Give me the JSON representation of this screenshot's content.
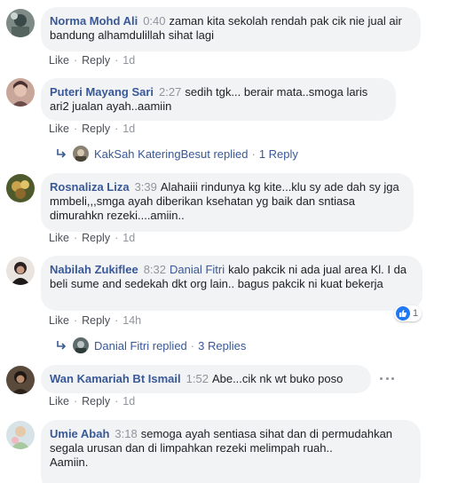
{
  "comments": [
    {
      "author": "Norma Mohd Ali",
      "time": "0:40",
      "mention": "",
      "text": "zaman kita sekolah rendah pak cik nie jual air bandung alhamdulillah sihat lagi",
      "actions": {
        "like": "Like",
        "reply": "Reply",
        "age": "1d"
      }
    },
    {
      "author": "Puteri Mayang Sari",
      "time": "2:27",
      "mention": "",
      "text": "sedih tgk... berair mata..smoga laris ari2 jualan ayah..aamiin",
      "actions": {
        "like": "Like",
        "reply": "Reply",
        "age": "1d"
      },
      "replies": {
        "name": "KakSah KateringBesut",
        "verb": "replied",
        "count": "1 Reply"
      }
    },
    {
      "author": "Rosnaliza Liza",
      "time": "3:39",
      "mention": "",
      "text": "Alahaiii rindunya kg kite...klu sy ade dah sy jga mmbeli,,,smga ayah diberikan ksehatan yg baik dan sntiasa dimurahkn rezeki....amiin..",
      "actions": {
        "like": "Like",
        "reply": "Reply",
        "age": "1d"
      }
    },
    {
      "author": "Nabilah Zukiflee",
      "time": "8:32",
      "mention": "Danial Fitri",
      "text": "kalo pakcik ni ada jual area Kl. I da beli sume and sedekah dkt org lain.. bagus pakcik ni kuat bekerja",
      "actions": {
        "like": "Like",
        "reply": "Reply",
        "age": "14h"
      },
      "reaction_count": "1",
      "replies": {
        "name": "Danial Fitri",
        "verb": "replied",
        "count": "3 Replies"
      }
    },
    {
      "author": "Wan Kamariah Bt Ismail",
      "time": "1:52",
      "mention": "",
      "text": "Abe...cik nk wt buko poso",
      "actions": {
        "like": "Like",
        "reply": "Reply",
        "age": "1d"
      }
    },
    {
      "author": "Umie Abah",
      "time": "3:18",
      "mention": "",
      "text": "semoga ayah sentiasa sihat dan di permudahkan segala urusan dan di limpahkan rezeki melimpah ruah..",
      "text2": "Aamiin."
    }
  ],
  "colors": {
    "link": "#385898",
    "bubble": "#f2f3f5",
    "meta": "#90949c",
    "like_badge": "#2078f4"
  },
  "icons": [
    "reply-arrow-icon",
    "like-reaction-icon",
    "more-options-icon"
  ]
}
